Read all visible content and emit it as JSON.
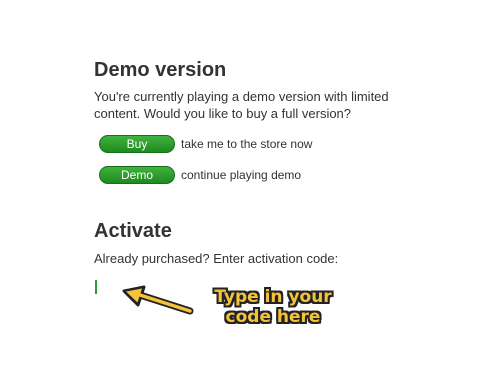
{
  "demo": {
    "title": "Demo version",
    "description": "You're currently playing a demo version with limited content. Would you like to buy a full version?",
    "buy_label": "Buy",
    "buy_caption": "take me to the store now",
    "demo_label": "Demo",
    "demo_caption": "continue playing demo"
  },
  "activate": {
    "title": "Activate",
    "description": "Already purchased? Enter activation code:",
    "code_value": "",
    "hint_line1": "Type in your",
    "hint_line2": "code here"
  },
  "colors": {
    "button_green": "#2a9a2a",
    "hint_yellow": "#f5c33b",
    "caret_green": "#2ca02c"
  },
  "icons": {
    "hint_arrow": "left-pointing-arrow-icon"
  }
}
